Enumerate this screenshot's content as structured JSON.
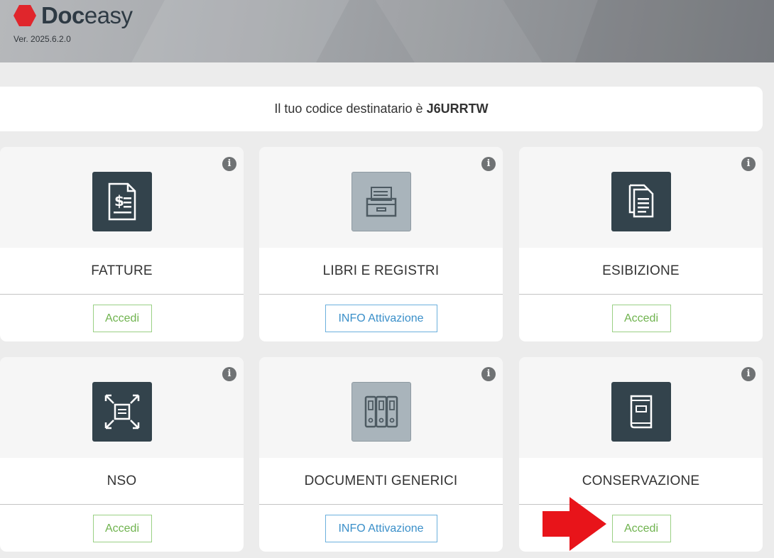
{
  "header": {
    "logo_bold": "Doc",
    "logo_light": "easy",
    "version": "Ver. 2025.6.2.0"
  },
  "banner": {
    "prefix": "Il tuo codice destinatario è",
    "code": "J6URRTW"
  },
  "cards": [
    {
      "title": "FATTURE",
      "button": "Accedi",
      "button_style": "green",
      "icon": "invoice-icon",
      "tile": "dark"
    },
    {
      "title": "LIBRI E REGISTRI",
      "button": "INFO Attivazione",
      "button_style": "blue",
      "icon": "archive-drawer-icon",
      "tile": "light"
    },
    {
      "title": "ESIBIZIONE",
      "button": "Accedi",
      "button_style": "green",
      "icon": "documents-icon",
      "tile": "dark"
    },
    {
      "title": "NSO",
      "button": "Accedi",
      "button_style": "green",
      "icon": "document-exchange-icon",
      "tile": "dark"
    },
    {
      "title": "DOCUMENTI GENERICI",
      "button": "INFO Attivazione",
      "button_style": "blue",
      "icon": "binders-icon",
      "tile": "light"
    },
    {
      "title": "CONSERVAZIONE",
      "button": "Accedi",
      "button_style": "green",
      "icon": "book-icon",
      "tile": "dark"
    }
  ],
  "info_icon": "info-icon",
  "colors": {
    "brand_red": "#e0262c",
    "tile_dark": "#33434c",
    "tile_light": "#a9b4bb",
    "accedi_green": "#6fb34e",
    "info_blue": "#3a8fc9",
    "arrow_red": "#e8141a"
  }
}
